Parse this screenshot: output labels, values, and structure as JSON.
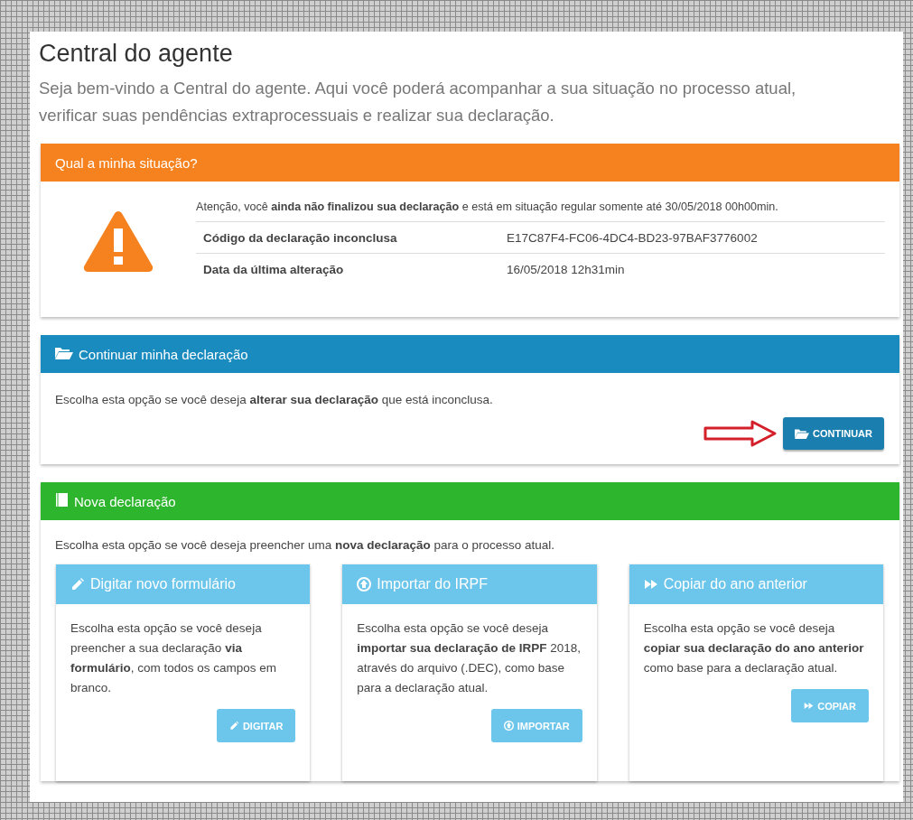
{
  "page": {
    "title": "Central do agente",
    "intro": "Seja bem-vindo a Central do agente. Aqui você poderá acompanhar a sua situação no processo atual, verificar suas pendências extraprocessuais e realizar sua declaração."
  },
  "situation": {
    "header": "Qual a minha situação?",
    "notice": "Atenção, você **ainda não finalizou sua declaração** e está em situação regular somente até 30/05/2018 00h00min.",
    "rows": [
      {
        "label": "Código da declaração inconclusa",
        "value": "E17C87F4-FC06-4DC4-BD23-97BAF3776002"
      },
      {
        "label": "Data da última alteração",
        "value": "16/05/2018 12h31min"
      }
    ]
  },
  "continue": {
    "header": "Continuar minha declaração",
    "text": "Escolha esta opção se você deseja **alterar sua declaração** que está inconclusa.",
    "button": "CONTINUAR"
  },
  "new": {
    "header": "Nova declaração",
    "text": "Escolha esta opção se você deseja preencher uma **nova declaração** para o processo atual.",
    "options": [
      {
        "kind": "pencil",
        "title": "Digitar novo formulário",
        "text": "Escolha esta opção se você deseja preencher a sua declaração **via formulário**, com todos os campos em branco.",
        "button": "DIGITAR"
      },
      {
        "kind": "upload",
        "title": "Importar do IRPF",
        "text": "Escolha esta opção se você deseja **importar sua declaração de IRPF** 2018, através do arquivo (.DEC), como base para a declaração atual.",
        "button": "IMPORTAR"
      },
      {
        "kind": "forward",
        "title": "Copiar do ano anterior",
        "text": "Escolha esta opção se você deseja **copiar sua declaração do ano anterior** como base para a declaração atual.",
        "button": "COPIAR"
      }
    ]
  }
}
